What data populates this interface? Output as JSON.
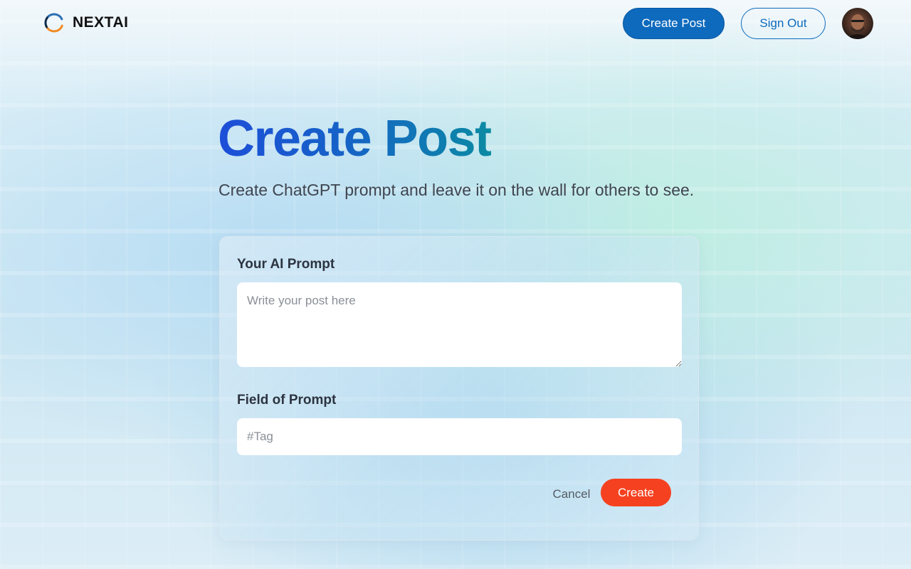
{
  "nav": {
    "brand": "NEXTAI",
    "create_post_label": "Create Post",
    "sign_out_label": "Sign Out"
  },
  "page": {
    "title": "Create Post",
    "subtitle": "Create ChatGPT prompt and leave it on the wall for others to see."
  },
  "form": {
    "prompt_label": "Your AI Prompt",
    "prompt_value": "",
    "prompt_placeholder": "Write your post here",
    "tag_label": "Field of Prompt",
    "tag_value": "",
    "tag_placeholder": "#Tag",
    "cancel_label": "Cancel",
    "submit_label": "Create"
  },
  "colors": {
    "primary_blue": "#0e6abd",
    "accent_orange": "#f5411f",
    "title_gradient_start": "#1d4ed8",
    "title_gradient_end": "#0b8aa3"
  },
  "icons": {
    "logo": "nextai-ring-logo",
    "avatar": "user-avatar"
  }
}
